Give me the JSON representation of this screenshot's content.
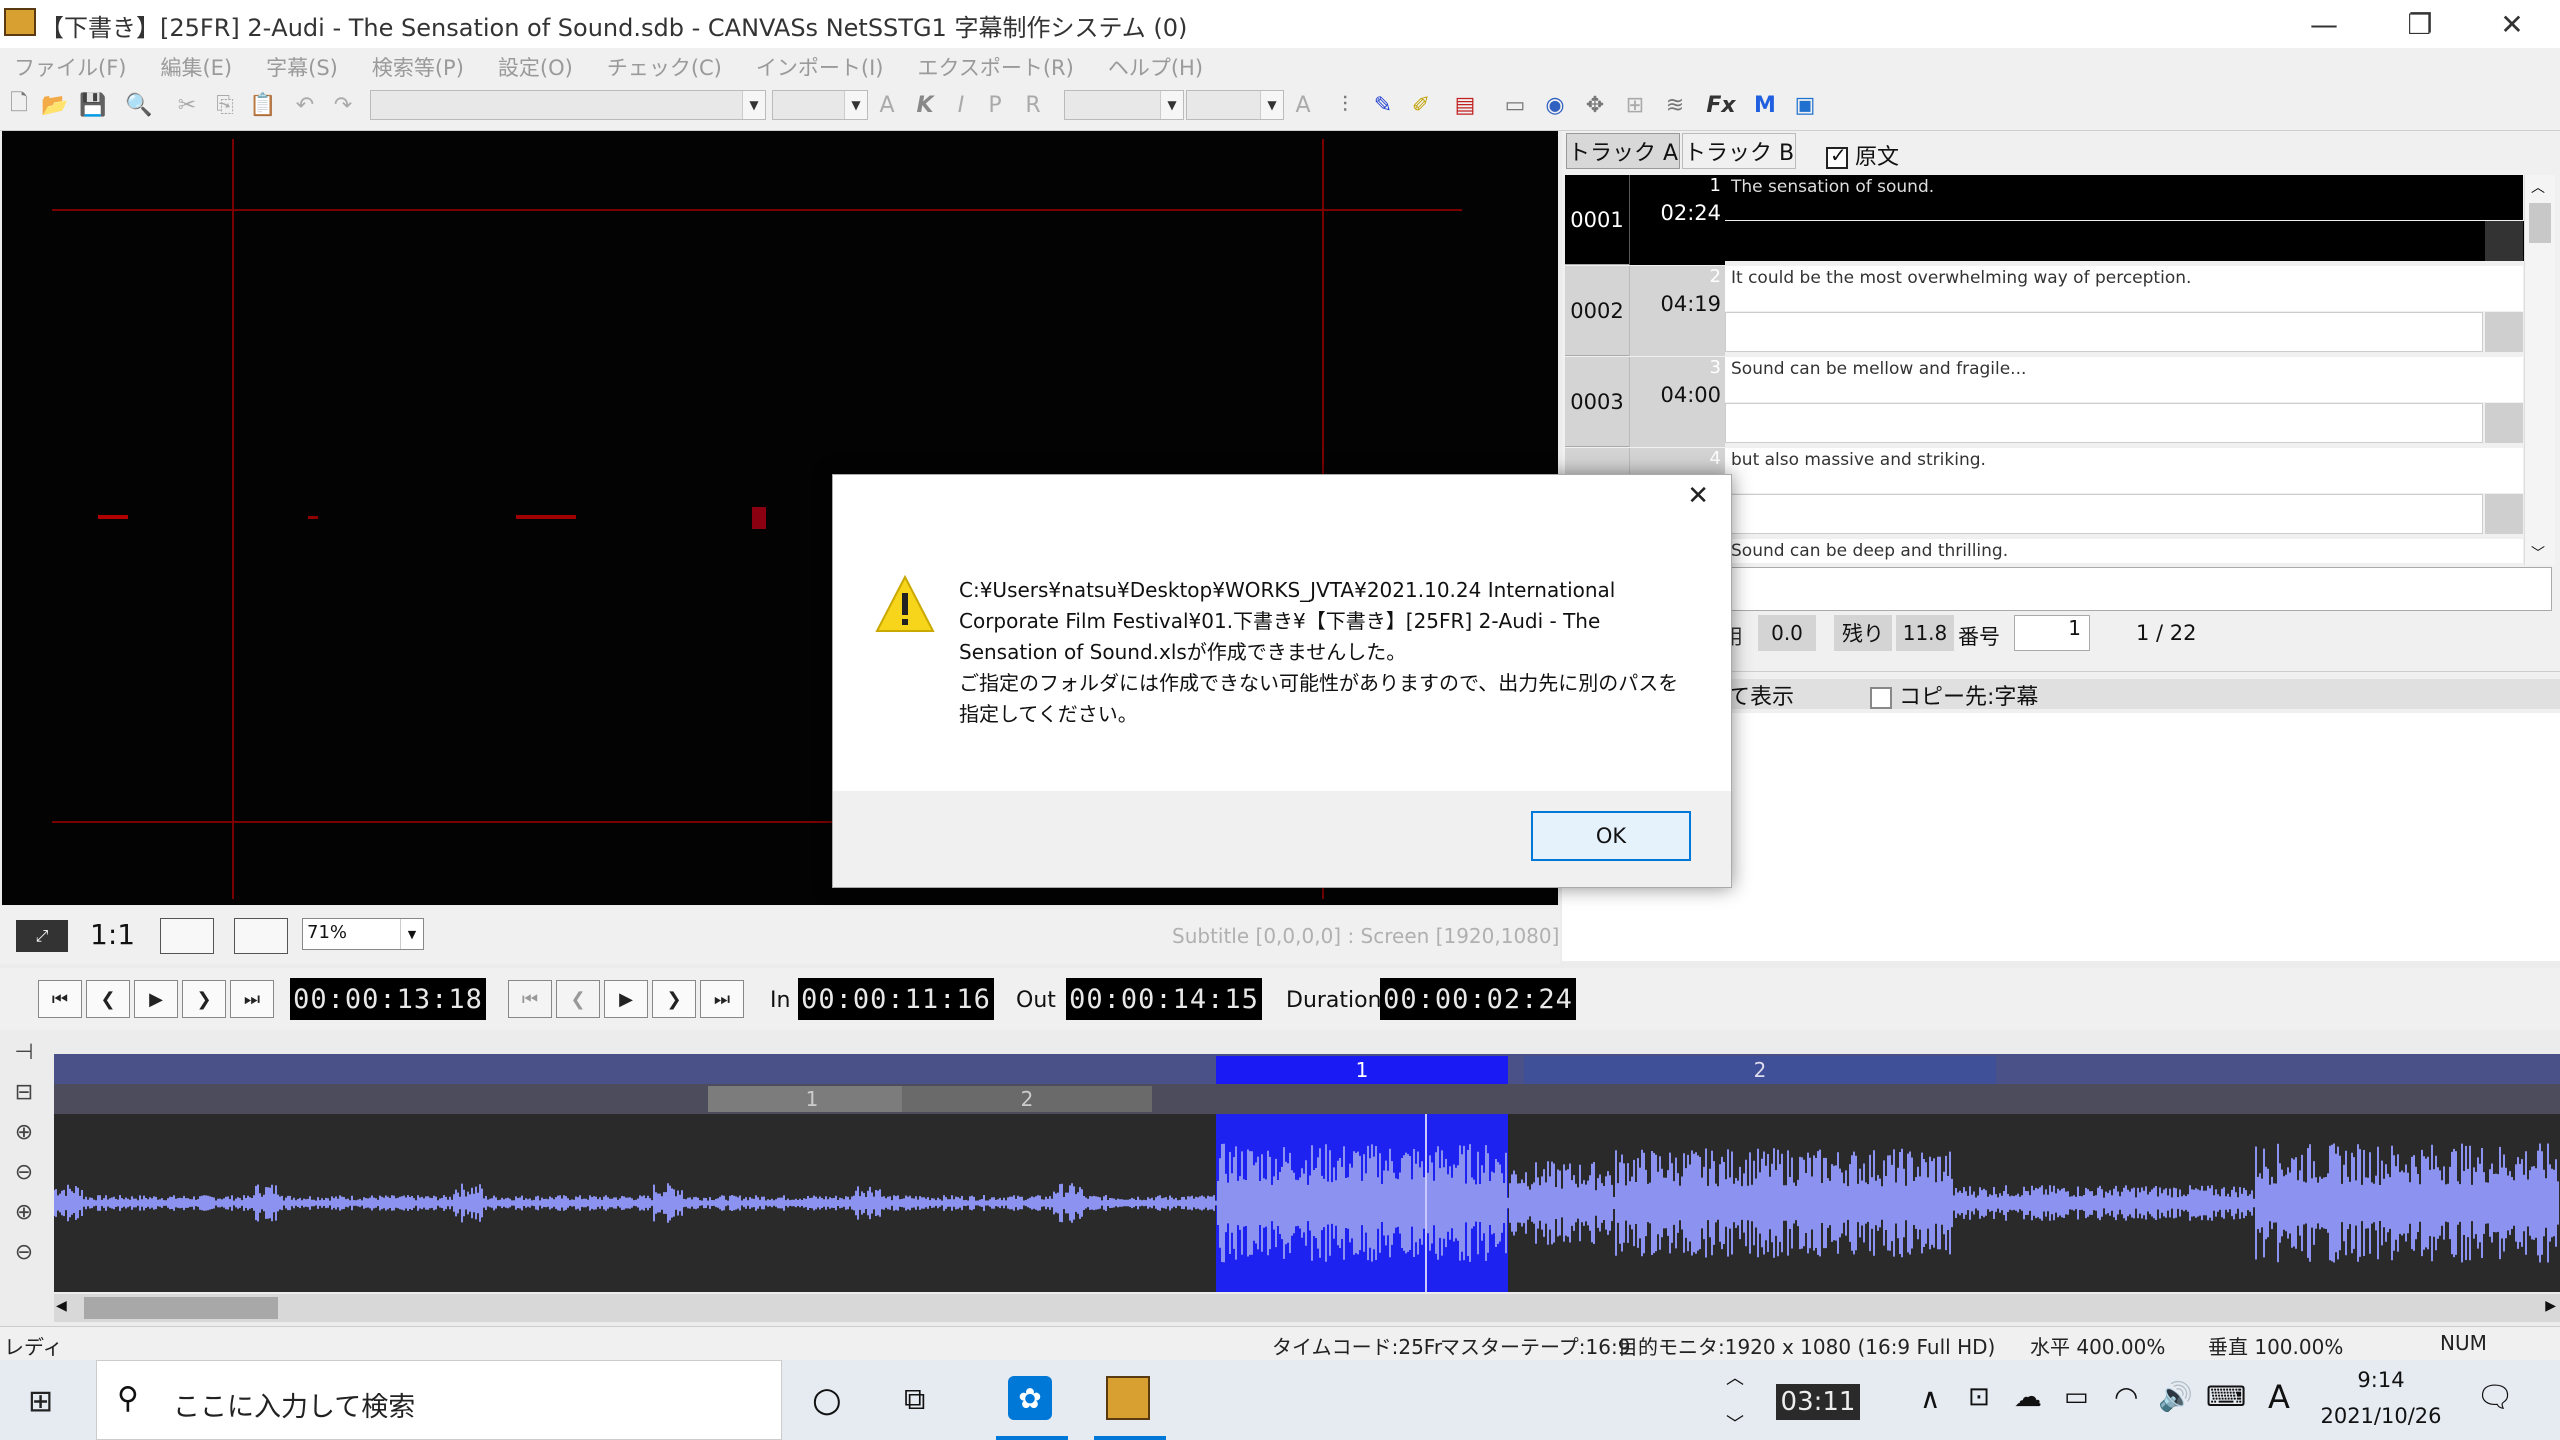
{
  "window": {
    "title": "【下書き】[25FR] 2-Audi - The Sensation of Sound.sdb - CANVASs NetSSTG1 字幕制作システム (0)",
    "minimize": "—",
    "restore": "❐",
    "close": "✕"
  },
  "menu": [
    "ファイル(F)",
    "編集(E)",
    "字幕(S)",
    "検索等(P)",
    "設定(O)",
    "チェック(C)",
    "インポート(I)",
    "エクスポート(R)",
    "ヘルプ(H)"
  ],
  "video": {
    "ratio_label": "1:1",
    "zoom": "71%",
    "info": "Subtitle [0,0,0,0] : Screen [1920,1080]"
  },
  "track_panel": {
    "tab_a": "トラック A",
    "tab_b": "トラック B",
    "source_checkbox": "原文",
    "subtitles": [
      {
        "num": "0001",
        "index": "1",
        "tc": "02:24",
        "text": "The sensation of sound."
      },
      {
        "num": "0002",
        "index": "2",
        "tc": "04:19",
        "text": "It could be the most overwhelming way of perception."
      },
      {
        "num": "0003",
        "index": "3",
        "tc": "04:00",
        "text": "Sound can be mellow and fragile..."
      },
      {
        "num": "",
        "index": "4",
        "tc": "",
        "text": "but also massive and striking."
      },
      {
        "num": "",
        "index": "",
        "tc": "",
        "text": "Sound can be deep and thrilling."
      }
    ],
    "stats": {
      "used_label": "用",
      "used_value": "0.0",
      "remain_label": "残り",
      "remain_value": "11.8",
      "number_label": "番号",
      "number_value": "1",
      "position": "1 / 22"
    },
    "show_label": "て表示",
    "copy_checkbox": "コピー先:字幕"
  },
  "transport": {
    "current_tc": "00:00:13:18",
    "in_label": "In",
    "in_tc": "00:00:11:16",
    "out_label": "Out",
    "out_tc": "00:00:14:15",
    "duration_label": "Duration",
    "duration_tc": "00:00:02:24"
  },
  "timeline": {
    "track_a_blocks": [
      "1",
      "2"
    ],
    "track_b_blocks": [
      "1",
      "2"
    ]
  },
  "status": {
    "ready": "レディ",
    "timecode": "タイムコード:25Fr",
    "master": "マスターテープ:16:9",
    "monitor": "目的モニタ:1920 x 1080 (16:9 Full HD)",
    "horizontal": "水平 400.00%",
    "vertical": "垂直 100.00%",
    "num": "NUM"
  },
  "dialog": {
    "message_line1": "C:¥Users¥natsu¥Desktop¥WORKS_JVTA¥2021.10.24 International",
    "message_line2": "Corporate Film Festival¥01.下書き¥【下書き】[25FR] 2-Audi - The",
    "message_line3": "Sensation of Sound.xlsが作成できませんした。",
    "message_line4": "ご指定のフォルダには作成できない可能性がありますので、出力先に別のパスを",
    "message_line5": "指定してください。",
    "ok": "OK",
    "close": "✕"
  },
  "taskbar": {
    "search_placeholder": "ここに入力して検索",
    "clock_widget": "03:11",
    "ime": "A",
    "time": "9:14",
    "date": "2021/10/26"
  },
  "colors": {
    "accent": "#0078d7",
    "selection_blue": "#1e22f0",
    "waveform": "#8c92f0",
    "timeline_bg": "#2a2a2a",
    "block_blue": "#2f3f8a"
  }
}
